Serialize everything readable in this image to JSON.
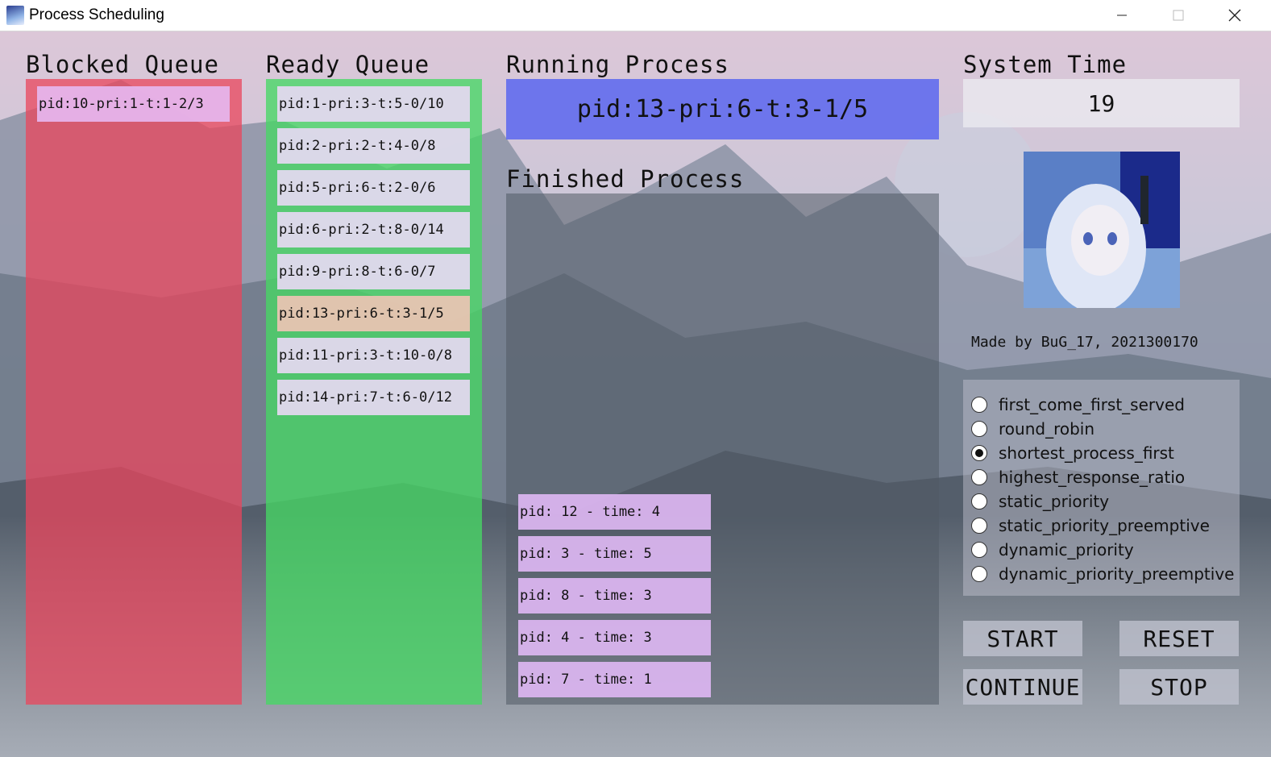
{
  "window": {
    "title": "Process Scheduling"
  },
  "blocked": {
    "heading": "Blocked Queue",
    "items": [
      "pid:10-pri:1-t:1-2/3"
    ]
  },
  "ready": {
    "heading": "Ready Queue",
    "items": [
      "pid:1-pri:3-t:5-0/10",
      "pid:2-pri:2-t:4-0/8",
      "pid:5-pri:6-t:2-0/6",
      "pid:6-pri:2-t:8-0/14",
      "pid:9-pri:8-t:6-0/7",
      "pid:13-pri:6-t:3-1/5",
      "pid:11-pri:3-t:10-0/8",
      "pid:14-pri:7-t:6-0/12"
    ]
  },
  "running": {
    "heading": "Running Process",
    "value": "pid:13-pri:6-t:3-1/5"
  },
  "finished": {
    "heading": "Finished Process",
    "items": [
      "pid: 12 - time: 4",
      "pid: 3 - time: 5",
      "pid: 8 - time: 3",
      "pid: 4 - time: 3",
      "pid: 7 - time: 1"
    ]
  },
  "system": {
    "heading": "System Time",
    "value": "19"
  },
  "credit": "Made by BuG_17, 2021300170",
  "algorithms": {
    "selected": "shortest_process_first",
    "options": [
      "first_come_first_served",
      "round_robin",
      "shortest_process_first",
      "highest_response_ratio",
      "static_priority",
      "static_priority_preemptive",
      "dynamic_priority",
      "dynamic_priority_preemptive"
    ]
  },
  "buttons": {
    "start": "START",
    "reset": "RESET",
    "continue": "CONTINUE",
    "stop": "STOP"
  },
  "colors": {
    "blocked_bg": "#e9586a",
    "ready_bg": "#4fd86a",
    "running_bg": "#6e72ee",
    "finished_bg": "#5f6b76",
    "item_default": "#e2d8ee",
    "item_highlight": "#e8c4b2",
    "item_finished": "#d9b4ee"
  }
}
